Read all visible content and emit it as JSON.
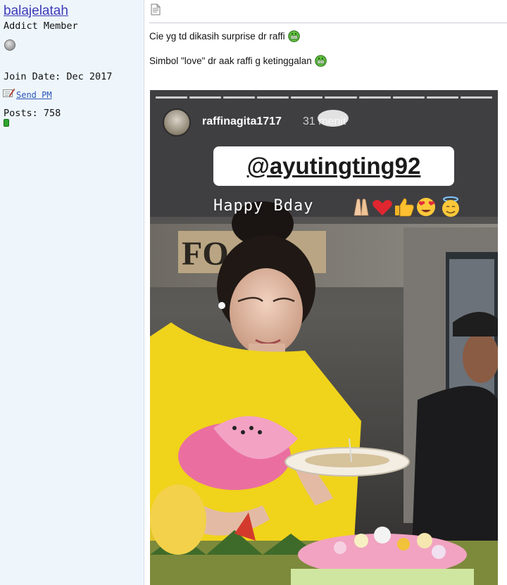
{
  "user": {
    "name": "balajelatah",
    "title": "Addict Member",
    "join_date": "Join Date: Dec 2017",
    "send_pm": "Send PM",
    "posts": "Posts: 758"
  },
  "post": {
    "line1": "Cie yg td dikasih surprise dr raffi",
    "line2": "Simbol \"love\" dr aak raffi g ketinggalan"
  },
  "story": {
    "username": "raffinagita1717",
    "time": "31 menit",
    "mention": "@ayutingting92",
    "caption": "Happy Bday",
    "emojis": [
      "folded-hands",
      "red-heart",
      "thumbs-up",
      "heart-eyes",
      "smiling-halo"
    ]
  },
  "colors": {
    "sidebar_bg": "#eef6fc",
    "username_link": "#3b3bb8",
    "pm_link": "#2a55b8",
    "reputation": "#2ea52e"
  }
}
